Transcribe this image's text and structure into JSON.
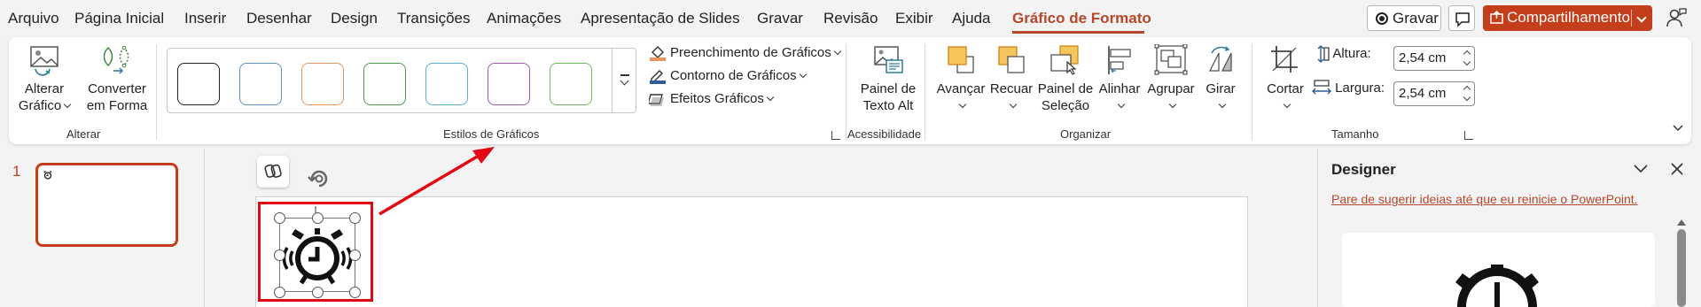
{
  "menu": {
    "tabs": [
      "Arquivo",
      "Página Inicial",
      "Inserir",
      "Desenhar",
      "Design",
      "Transições",
      "Animações",
      "Apresentação de Slides",
      "Gravar",
      "Revisão",
      "Exibir",
      "Ajuda",
      "Gráfico de Formato"
    ],
    "active_tab": "Gráfico de Formato",
    "record_label": "Gravar",
    "share_label": "Compartilhamento"
  },
  "ribbon": {
    "alterar": {
      "change_graphic": [
        "Alterar",
        "Gráfico"
      ],
      "convert_shape": [
        "Converter",
        "em Forma"
      ],
      "group_label": "Alterar"
    },
    "styles": {
      "swatch_colors": [
        "#222222",
        "#5b8fc7",
        "#e8965a",
        "#4a9a4a",
        "#5aaed8",
        "#a257b5",
        "#6cbf5a"
      ],
      "fill_label": "Preenchimento de Gráficos",
      "outline_label": "Contorno de Gráficos",
      "effects_label": "Efeitos Gráficos",
      "group_label": "Estilos de Gráficos"
    },
    "accessibility": {
      "alt_text": [
        "Painel de",
        "Texto Alt"
      ],
      "group_label": "Acessibilidade"
    },
    "arrange": {
      "bring_forward": "Avançar",
      "send_backward": "Recuar",
      "selection_pane": [
        "Painel de",
        "Seleção"
      ],
      "align": "Alinhar",
      "group": "Agrupar",
      "rotate": "Girar",
      "group_label": "Organizar"
    },
    "size": {
      "crop": "Cortar",
      "height_label": "Altura:",
      "height_value": "2,54 cm",
      "width_label": "Largura:",
      "width_value": "2,54 cm",
      "group_label": "Tamanho"
    }
  },
  "slides": {
    "number": "1"
  },
  "designer": {
    "title": "Designer",
    "link": "Pare de sugerir ideias até que eu reinicie o PowerPoint."
  },
  "colors": {
    "accent": "#b7472a",
    "share_bg": "#c43e1c",
    "annotation_red": "#e30613"
  }
}
